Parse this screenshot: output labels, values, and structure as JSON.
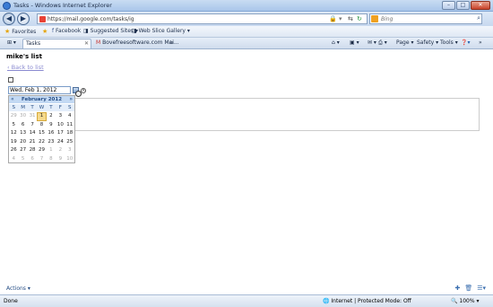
{
  "window": {
    "title": "Tasks - Windows Internet Explorer"
  },
  "addressbar": {
    "url": "https://mail.google.com/tasks/ig",
    "search_placeholder": "Bing"
  },
  "favorites": {
    "label": "Favorites",
    "items": [
      "Facebook",
      "Suggested Sites",
      "Web Slice Gallery"
    ]
  },
  "tabs": [
    {
      "label": "Tasks"
    },
    {
      "label": "Bovefreesoftware.com Mai..."
    }
  ],
  "commandbar": {
    "page": "Page",
    "safety": "Safety",
    "tools": "Tools"
  },
  "page": {
    "list_title": "mike's list",
    "back_link": "‹ Back to list",
    "date_value": "Wed, Feb 1, 2012"
  },
  "calendar": {
    "month_label": "February 2012",
    "prev": "«",
    "next": "»",
    "dows": [
      "S",
      "M",
      "T",
      "W",
      "T",
      "F",
      "S"
    ],
    "days": [
      {
        "d": "29",
        "o": true
      },
      {
        "d": "30",
        "o": true
      },
      {
        "d": "31",
        "o": true
      },
      {
        "d": "1",
        "sel": true
      },
      {
        "d": "2"
      },
      {
        "d": "3"
      },
      {
        "d": "4"
      },
      {
        "d": "5"
      },
      {
        "d": "6"
      },
      {
        "d": "7"
      },
      {
        "d": "8"
      },
      {
        "d": "9"
      },
      {
        "d": "10"
      },
      {
        "d": "11"
      },
      {
        "d": "12"
      },
      {
        "d": "13"
      },
      {
        "d": "14"
      },
      {
        "d": "15"
      },
      {
        "d": "16"
      },
      {
        "d": "17"
      },
      {
        "d": "18"
      },
      {
        "d": "19"
      },
      {
        "d": "20"
      },
      {
        "d": "21"
      },
      {
        "d": "22"
      },
      {
        "d": "23"
      },
      {
        "d": "24"
      },
      {
        "d": "25"
      },
      {
        "d": "26"
      },
      {
        "d": "27"
      },
      {
        "d": "28"
      },
      {
        "d": "29"
      },
      {
        "d": "1",
        "o": true
      },
      {
        "d": "2",
        "o": true
      },
      {
        "d": "3",
        "o": true
      },
      {
        "d": "4",
        "o": true
      },
      {
        "d": "5",
        "o": true
      },
      {
        "d": "6",
        "o": true
      },
      {
        "d": "7",
        "o": true
      },
      {
        "d": "8",
        "o": true
      },
      {
        "d": "9",
        "o": true
      },
      {
        "d": "10",
        "o": true
      }
    ]
  },
  "footer": {
    "actions": "Actions ▾"
  },
  "statusbar": {
    "status": "Done",
    "zone": "Internet | Protected Mode: Off",
    "zoom": "100%"
  }
}
